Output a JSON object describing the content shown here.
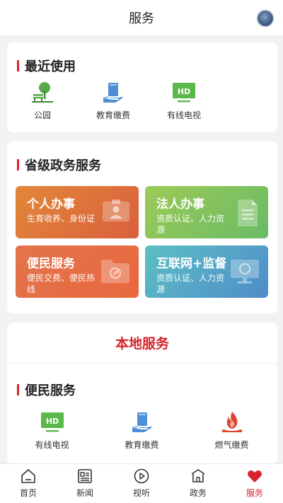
{
  "header": {
    "title": "服务"
  },
  "recent": {
    "title": "最近使用",
    "items": [
      {
        "label": "公园",
        "icon": "park-icon"
      },
      {
        "label": "教育缴费",
        "icon": "book-hand-icon"
      },
      {
        "label": "有线电视",
        "icon": "tv-hd-icon"
      }
    ]
  },
  "provincial": {
    "title": "省级政务服务",
    "tiles": [
      {
        "title": "个人办事",
        "subtitle": "生育收养、身份证",
        "icon": "id-card-icon",
        "color_from": "#e07a3a",
        "color_to": "#de6a3c"
      },
      {
        "title": "法人办事",
        "subtitle": "资质认证、人力资源",
        "icon": "document-icon",
        "color_from": "#8fc85a",
        "color_to": "#6bbd6a"
      },
      {
        "title": "便民服务",
        "subtitle": "便民交费、便民热线",
        "icon": "folder-icon",
        "color_from": "#e46a4e",
        "color_to": "#e8724c"
      },
      {
        "title": "互联网+监督",
        "subtitle": "资质认证、人力资源",
        "icon": "monitor-icon",
        "color_from": "#56b6c4",
        "color_to": "#4f95cc"
      }
    ]
  },
  "local": {
    "title": "本地服务",
    "section_title": "便民服务",
    "items": [
      {
        "label": "有线电视",
        "icon": "tv-hd-icon"
      },
      {
        "label": "教育缴费",
        "icon": "book-hand-icon"
      },
      {
        "label": "燃气缴费",
        "icon": "flame-icon"
      }
    ]
  },
  "tv_badge": "HD",
  "tabs": [
    {
      "label": "首页",
      "icon": "home-icon",
      "active": false
    },
    {
      "label": "新闻",
      "icon": "news-icon",
      "active": false
    },
    {
      "label": "视听",
      "icon": "play-icon",
      "active": false
    },
    {
      "label": "政务",
      "icon": "government-icon",
      "active": false
    },
    {
      "label": "服务",
      "icon": "heart-icon",
      "active": true
    }
  ],
  "colors": {
    "accent_red": "#d9232e",
    "icon_green": "#5aa84a",
    "icon_blue": "#4d8fd6",
    "flame_red": "#e0432a"
  }
}
